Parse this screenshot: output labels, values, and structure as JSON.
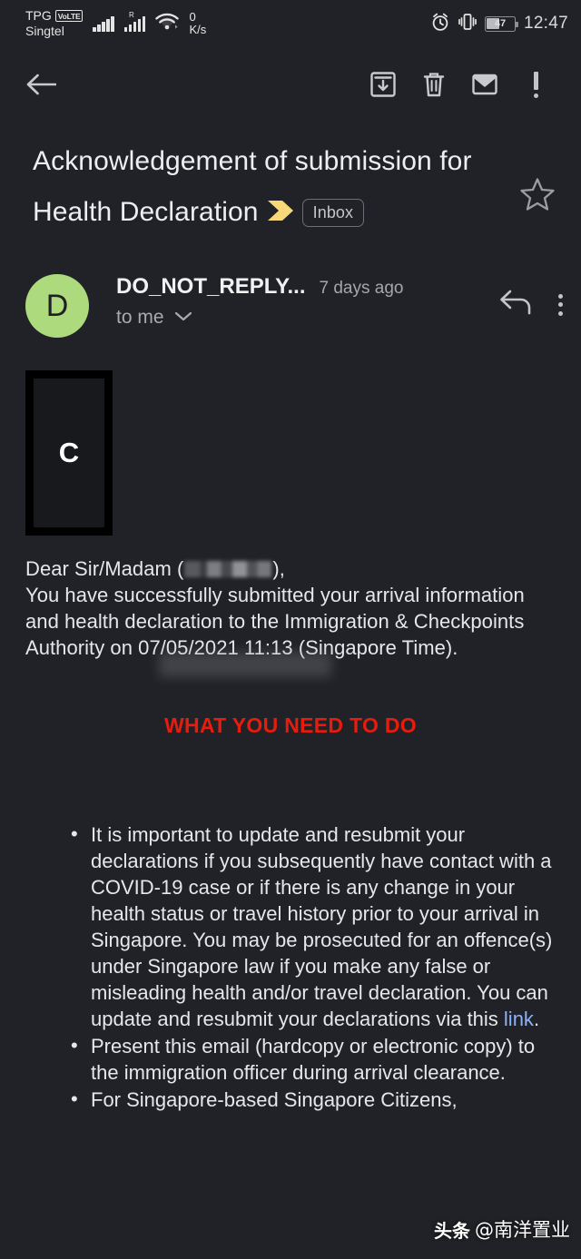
{
  "status_bar": {
    "carrier_primary": "TPG",
    "volte_badge": "VoLTE",
    "carrier_secondary": "Singtel",
    "roaming_indicator": "R",
    "data_rate_value": "0",
    "data_rate_unit": "K/s",
    "battery_percent": "47",
    "clock": "12:47"
  },
  "action_bar": {
    "back_label": "back-arrow",
    "archive_label": "archive",
    "delete_label": "delete",
    "mark_unread_label": "mark-unread",
    "more_label": "more-options"
  },
  "email": {
    "subject": "Acknowledgement of submission for Health Declaration",
    "label_chip": "Inbox",
    "starred": false,
    "sender_name": "DO_NOT_REPLY...",
    "sender_initial": "D",
    "timestamp": "7 days ago",
    "recipient": "to me",
    "image_placeholder_letter": "C"
  },
  "body": {
    "greeting_prefix": "Dear Sir/Madam (",
    "greeting_redacted": "∗∗∗∗∗∗∗∗∗",
    "greeting_suffix": "),",
    "intro": "You have successfully submitted your arrival information and health declaration to the Immigration & Checkpoints Authority on 07/05/2021 11:13 (Singapore Time).",
    "section_heading": "WHAT YOU NEED TO DO",
    "bullets": [
      {
        "text_before_link": "It is important to update and resubmit your declarations if you subsequently have contact with a COVID-19 case or if there is any change in your health status or travel history prior to your arrival in Singapore. You may be prosecuted for an offence(s) under Singapore law if you make any false or misleading health and/or travel declaration. You can update and resubmit your declarations via this ",
        "link_text": "link",
        "text_after_link": "."
      },
      {
        "text_before_link": "Present this email (hardcopy or electronic copy) to the immigration officer during arrival clearance.",
        "link_text": "",
        "text_after_link": ""
      },
      {
        "text_before_link": "For Singapore-based Singapore Citizens,",
        "link_text": "",
        "text_after_link": ""
      }
    ]
  },
  "watermark": {
    "logo_text": "头条",
    "handle": "@南洋置业"
  },
  "colors": {
    "background": "#212227",
    "accent_red": "#e81c0d",
    "link_blue": "#8ab4f8",
    "avatar_green": "#adda7c",
    "importance_yellow": "#f6d87a"
  }
}
